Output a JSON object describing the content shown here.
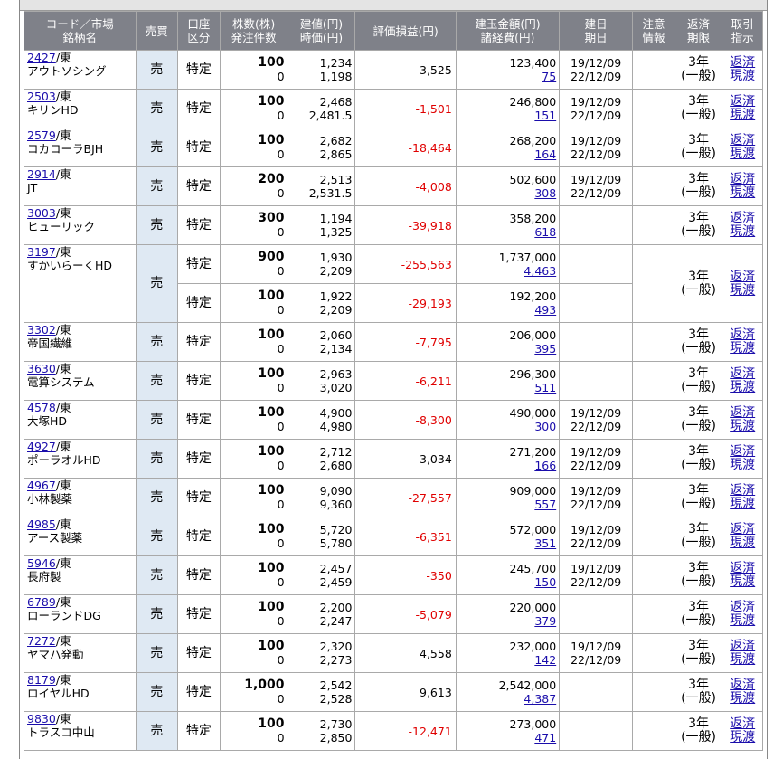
{
  "headers": {
    "name": [
      "コード／市場",
      "銘柄名"
    ],
    "side": [
      "売買"
    ],
    "account": [
      "口座",
      "区分"
    ],
    "qty": [
      "株数(株)",
      "発注件数"
    ],
    "price": [
      "建値(円)",
      "時価(円)"
    ],
    "pnl": [
      "評価損益(円)"
    ],
    "amount": [
      "建玉金額(円)",
      "諸経費(円)"
    ],
    "date": [
      "建日",
      "期日"
    ],
    "note": [
      "注意",
      "情報"
    ],
    "term": [
      "返済",
      "期限"
    ],
    "action": [
      "取引",
      "指示"
    ]
  },
  "positions": [
    {
      "code": "2427",
      "market": "/東",
      "name": "アウトソシング",
      "side": "売",
      "rows": [
        {
          "account": "特定",
          "qty": "100",
          "orders": "0",
          "entry": "1,234",
          "current": "1,198",
          "pnl": "3,525",
          "amount": "123,400",
          "fee": "75",
          "open": "19/12/09",
          "expiry": "22/12/09"
        }
      ],
      "term1": "3年",
      "term2": "(一般)",
      "act1": "返済",
      "act2": "現渡"
    },
    {
      "code": "2503",
      "market": "/東",
      "name": "キリンHD",
      "side": "売",
      "rows": [
        {
          "account": "特定",
          "qty": "100",
          "orders": "0",
          "entry": "2,468",
          "current": "2,481.5",
          "pnl": "-1,501",
          "amount": "246,800",
          "fee": "151",
          "open": "19/12/09",
          "expiry": "22/12/09"
        }
      ],
      "term1": "3年",
      "term2": "(一般)",
      "act1": "返済",
      "act2": "現渡"
    },
    {
      "code": "2579",
      "market": "/東",
      "name": "コカコーラBJH",
      "side": "売",
      "rows": [
        {
          "account": "特定",
          "qty": "100",
          "orders": "0",
          "entry": "2,682",
          "current": "2,865",
          "pnl": "-18,464",
          "amount": "268,200",
          "fee": "164",
          "open": "19/12/09",
          "expiry": "22/12/09"
        }
      ],
      "term1": "3年",
      "term2": "(一般)",
      "act1": "返済",
      "act2": "現渡"
    },
    {
      "code": "2914",
      "market": "/東",
      "name": "JT",
      "side": "売",
      "rows": [
        {
          "account": "特定",
          "qty": "200",
          "orders": "0",
          "entry": "2,513",
          "current": "2,531.5",
          "pnl": "-4,008",
          "amount": "502,600",
          "fee": "308",
          "open": "19/12/09",
          "expiry": "22/12/09"
        }
      ],
      "term1": "3年",
      "term2": "(一般)",
      "act1": "返済",
      "act2": "現渡"
    },
    {
      "code": "3003",
      "market": "/東",
      "name": "ヒューリック",
      "side": "売",
      "rows": [
        {
          "account": "特定",
          "qty": "300",
          "orders": "0",
          "entry": "1,194",
          "current": "1,325",
          "pnl": "-39,918",
          "amount": "358,200",
          "fee": "618",
          "open": "",
          "expiry": ""
        }
      ],
      "term1": "3年",
      "term2": "(一般)",
      "act1": "返済",
      "act2": "現渡"
    },
    {
      "code": "3197",
      "market": "/東",
      "name": "すかいらーくHD",
      "side": "売",
      "rows": [
        {
          "account": "特定",
          "qty": "900",
          "orders": "0",
          "entry": "1,930",
          "current": "2,209",
          "pnl": "-255,563",
          "amount": "1,737,000",
          "fee": "4,463",
          "open": "",
          "expiry": ""
        },
        {
          "account": "特定",
          "qty": "100",
          "orders": "0",
          "entry": "1,922",
          "current": "2,209",
          "pnl": "-29,193",
          "amount": "192,200",
          "fee": "493",
          "open": "",
          "expiry": ""
        }
      ],
      "term1": "3年",
      "term2": "(一般)",
      "act1": "返済",
      "act2": "現渡"
    },
    {
      "code": "3302",
      "market": "/東",
      "name": "帝国繊維",
      "side": "売",
      "rows": [
        {
          "account": "特定",
          "qty": "100",
          "orders": "0",
          "entry": "2,060",
          "current": "2,134",
          "pnl": "-7,795",
          "amount": "206,000",
          "fee": "395",
          "open": "",
          "expiry": ""
        }
      ],
      "term1": "3年",
      "term2": "(一般)",
      "act1": "返済",
      "act2": "現渡"
    },
    {
      "code": "3630",
      "market": "/東",
      "name": "電算システム",
      "side": "売",
      "rows": [
        {
          "account": "特定",
          "qty": "100",
          "orders": "0",
          "entry": "2,963",
          "current": "3,020",
          "pnl": "-6,211",
          "amount": "296,300",
          "fee": "511",
          "open": "",
          "expiry": ""
        }
      ],
      "term1": "3年",
      "term2": "(一般)",
      "act1": "返済",
      "act2": "現渡"
    },
    {
      "code": "4578",
      "market": "/東",
      "name": "大塚HD",
      "side": "売",
      "rows": [
        {
          "account": "特定",
          "qty": "100",
          "orders": "0",
          "entry": "4,900",
          "current": "4,980",
          "pnl": "-8,300",
          "amount": "490,000",
          "fee": "300",
          "open": "19/12/09",
          "expiry": "22/12/09"
        }
      ],
      "term1": "3年",
      "term2": "(一般)",
      "act1": "返済",
      "act2": "現渡"
    },
    {
      "code": "4927",
      "market": "/東",
      "name": "ポーラオルHD",
      "side": "売",
      "rows": [
        {
          "account": "特定",
          "qty": "100",
          "orders": "0",
          "entry": "2,712",
          "current": "2,680",
          "pnl": "3,034",
          "amount": "271,200",
          "fee": "166",
          "open": "19/12/09",
          "expiry": "22/12/09"
        }
      ],
      "term1": "3年",
      "term2": "(一般)",
      "act1": "返済",
      "act2": "現渡"
    },
    {
      "code": "4967",
      "market": "/東",
      "name": "小林製薬",
      "side": "売",
      "rows": [
        {
          "account": "特定",
          "qty": "100",
          "orders": "0",
          "entry": "9,090",
          "current": "9,360",
          "pnl": "-27,557",
          "amount": "909,000",
          "fee": "557",
          "open": "19/12/09",
          "expiry": "22/12/09"
        }
      ],
      "term1": "3年",
      "term2": "(一般)",
      "act1": "返済",
      "act2": "現渡"
    },
    {
      "code": "4985",
      "market": "/東",
      "name": "アース製薬",
      "side": "売",
      "rows": [
        {
          "account": "特定",
          "qty": "100",
          "orders": "0",
          "entry": "5,720",
          "current": "5,780",
          "pnl": "-6,351",
          "amount": "572,000",
          "fee": "351",
          "open": "19/12/09",
          "expiry": "22/12/09"
        }
      ],
      "term1": "3年",
      "term2": "(一般)",
      "act1": "返済",
      "act2": "現渡"
    },
    {
      "code": "5946",
      "market": "/東",
      "name": "長府製",
      "side": "売",
      "rows": [
        {
          "account": "特定",
          "qty": "100",
          "orders": "0",
          "entry": "2,457",
          "current": "2,459",
          "pnl": "-350",
          "amount": "245,700",
          "fee": "150",
          "open": "19/12/09",
          "expiry": "22/12/09"
        }
      ],
      "term1": "3年",
      "term2": "(一般)",
      "act1": "返済",
      "act2": "現渡"
    },
    {
      "code": "6789",
      "market": "/東",
      "name": "ローランドDG",
      "side": "売",
      "rows": [
        {
          "account": "特定",
          "qty": "100",
          "orders": "0",
          "entry": "2,200",
          "current": "2,247",
          "pnl": "-5,079",
          "amount": "220,000",
          "fee": "379",
          "open": "",
          "expiry": ""
        }
      ],
      "term1": "3年",
      "term2": "(一般)",
      "act1": "返済",
      "act2": "現渡"
    },
    {
      "code": "7272",
      "market": "/東",
      "name": "ヤマハ発動",
      "side": "売",
      "rows": [
        {
          "account": "特定",
          "qty": "100",
          "orders": "0",
          "entry": "2,320",
          "current": "2,273",
          "pnl": "4,558",
          "amount": "232,000",
          "fee": "142",
          "open": "19/12/09",
          "expiry": "22/12/09"
        }
      ],
      "term1": "3年",
      "term2": "(一般)",
      "act1": "返済",
      "act2": "現渡"
    },
    {
      "code": "8179",
      "market": "/東",
      "name": "ロイヤルHD",
      "side": "売",
      "rows": [
        {
          "account": "特定",
          "qty": "1,000",
          "orders": "0",
          "entry": "2,542",
          "current": "2,528",
          "pnl": "9,613",
          "amount": "2,542,000",
          "fee": "4,387",
          "open": "",
          "expiry": ""
        }
      ],
      "term1": "3年",
      "term2": "(一般)",
      "act1": "返済",
      "act2": "現渡"
    },
    {
      "code": "9830",
      "market": "/東",
      "name": "トラスコ中山",
      "side": "売",
      "rows": [
        {
          "account": "特定",
          "qty": "100",
          "orders": "0",
          "entry": "2,730",
          "current": "2,850",
          "pnl": "-12,471",
          "amount": "273,000",
          "fee": "471",
          "open": "",
          "expiry": ""
        }
      ],
      "term1": "3年",
      "term2": "(一般)",
      "act1": "返済",
      "act2": "現渡"
    }
  ]
}
